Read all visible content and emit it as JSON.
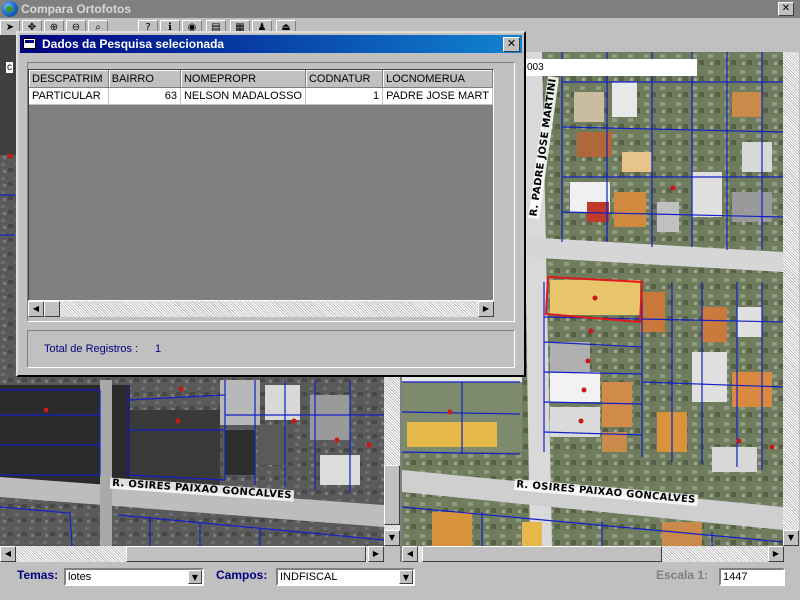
{
  "app": {
    "title": "Compara Ortofotos",
    "controls": {
      "minimize": "_",
      "maximize": "□",
      "close": "✕"
    }
  },
  "toolbar": {
    "buttons": [
      {
        "name": "arrow-icon",
        "glyph": "➤"
      },
      {
        "name": "pan-icon",
        "glyph": "✥"
      },
      {
        "name": "zoom-in-icon",
        "glyph": "⊕"
      },
      {
        "name": "zoom-out-icon",
        "glyph": "⊖"
      },
      {
        "name": "search-icon",
        "glyph": "⌕"
      },
      {
        "name": "help-icon",
        "glyph": "?"
      },
      {
        "name": "info-icon",
        "glyph": "ℹ"
      },
      {
        "name": "identify-icon",
        "glyph": "◉"
      },
      {
        "name": "print-icon",
        "glyph": "▤"
      },
      {
        "name": "layers-icon",
        "glyph": "▦"
      },
      {
        "name": "person-icon",
        "glyph": "♟"
      },
      {
        "name": "exit-icon",
        "glyph": "⏏"
      }
    ]
  },
  "map_left": {
    "coordinate_text": "c",
    "street_label": "R. OSIRES PAIXAO GONCALVES"
  },
  "map_right": {
    "coordinate_text": "003",
    "street_label_bottom": "R. OSIRES PAIXAO GONCALVES",
    "street_label_vertical": "R. PADRE JOSE MARTINI"
  },
  "dialog": {
    "title": "Dados da Pesquisa selecionada",
    "close_glyph": "✕",
    "columns": [
      "DESCPATRIM",
      "BAIRRO",
      "NOMEPROPR",
      "CODNATUR",
      "LOCNOMERUA"
    ],
    "rows": [
      [
        "PARTICULAR",
        "63",
        "NELSON MADALOSSO",
        "1",
        "PADRE JOSE MART"
      ]
    ],
    "total_label": "Total de Registros :",
    "total_value": "1"
  },
  "bottom": {
    "temas_label": "Temas:",
    "temas_value": "lotes",
    "campos_label": "Campos:",
    "campos_value": "INDFISCAL",
    "escala_label": "Escala 1:",
    "escala_value": "1447"
  },
  "colors": {
    "lot_lines": "#1020c8",
    "highlight": "#e01818",
    "dialog_title": "#000080",
    "label_blue": "#000080"
  }
}
